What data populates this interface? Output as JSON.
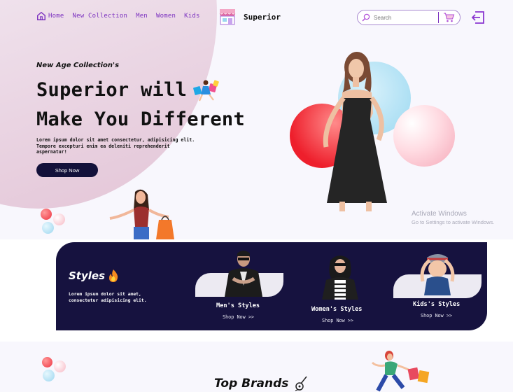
{
  "nav": {
    "items": [
      "Home",
      "New Collection",
      "Men",
      "Women",
      "Kids"
    ]
  },
  "brand": {
    "name": "Superior"
  },
  "search": {
    "placeholder": "Search"
  },
  "hero": {
    "tagline": "New Age Collection's",
    "headline_line1": "Superior will",
    "headline_line2": "Make You Different",
    "description": "Lorem ipsum dolor sit amet consectetur, adipisicing elit. Tempore excepturi enim ea deleniti reprehenderit aspernatur!",
    "button_label": "Shop Now"
  },
  "watermark": {
    "line1": "Activate Windows",
    "line2": "Go to Settings to activate Windows."
  },
  "styles": {
    "title": "Styles",
    "description": "Lorem ipsum dolor sit amet, consectetur adipisicing elit.",
    "categories": [
      {
        "name": "Men's Styles",
        "link": "Shop Now >>"
      },
      {
        "name": "Women's Styles",
        "link": "Shop Now >>"
      },
      {
        "name": "Kids's Styles",
        "link": "Shop Now >>"
      }
    ]
  },
  "top_brands": {
    "title": "Top Brands"
  },
  "colors": {
    "accent": "#7a2fbf",
    "dark": "#16123f",
    "button": "#13113a"
  }
}
